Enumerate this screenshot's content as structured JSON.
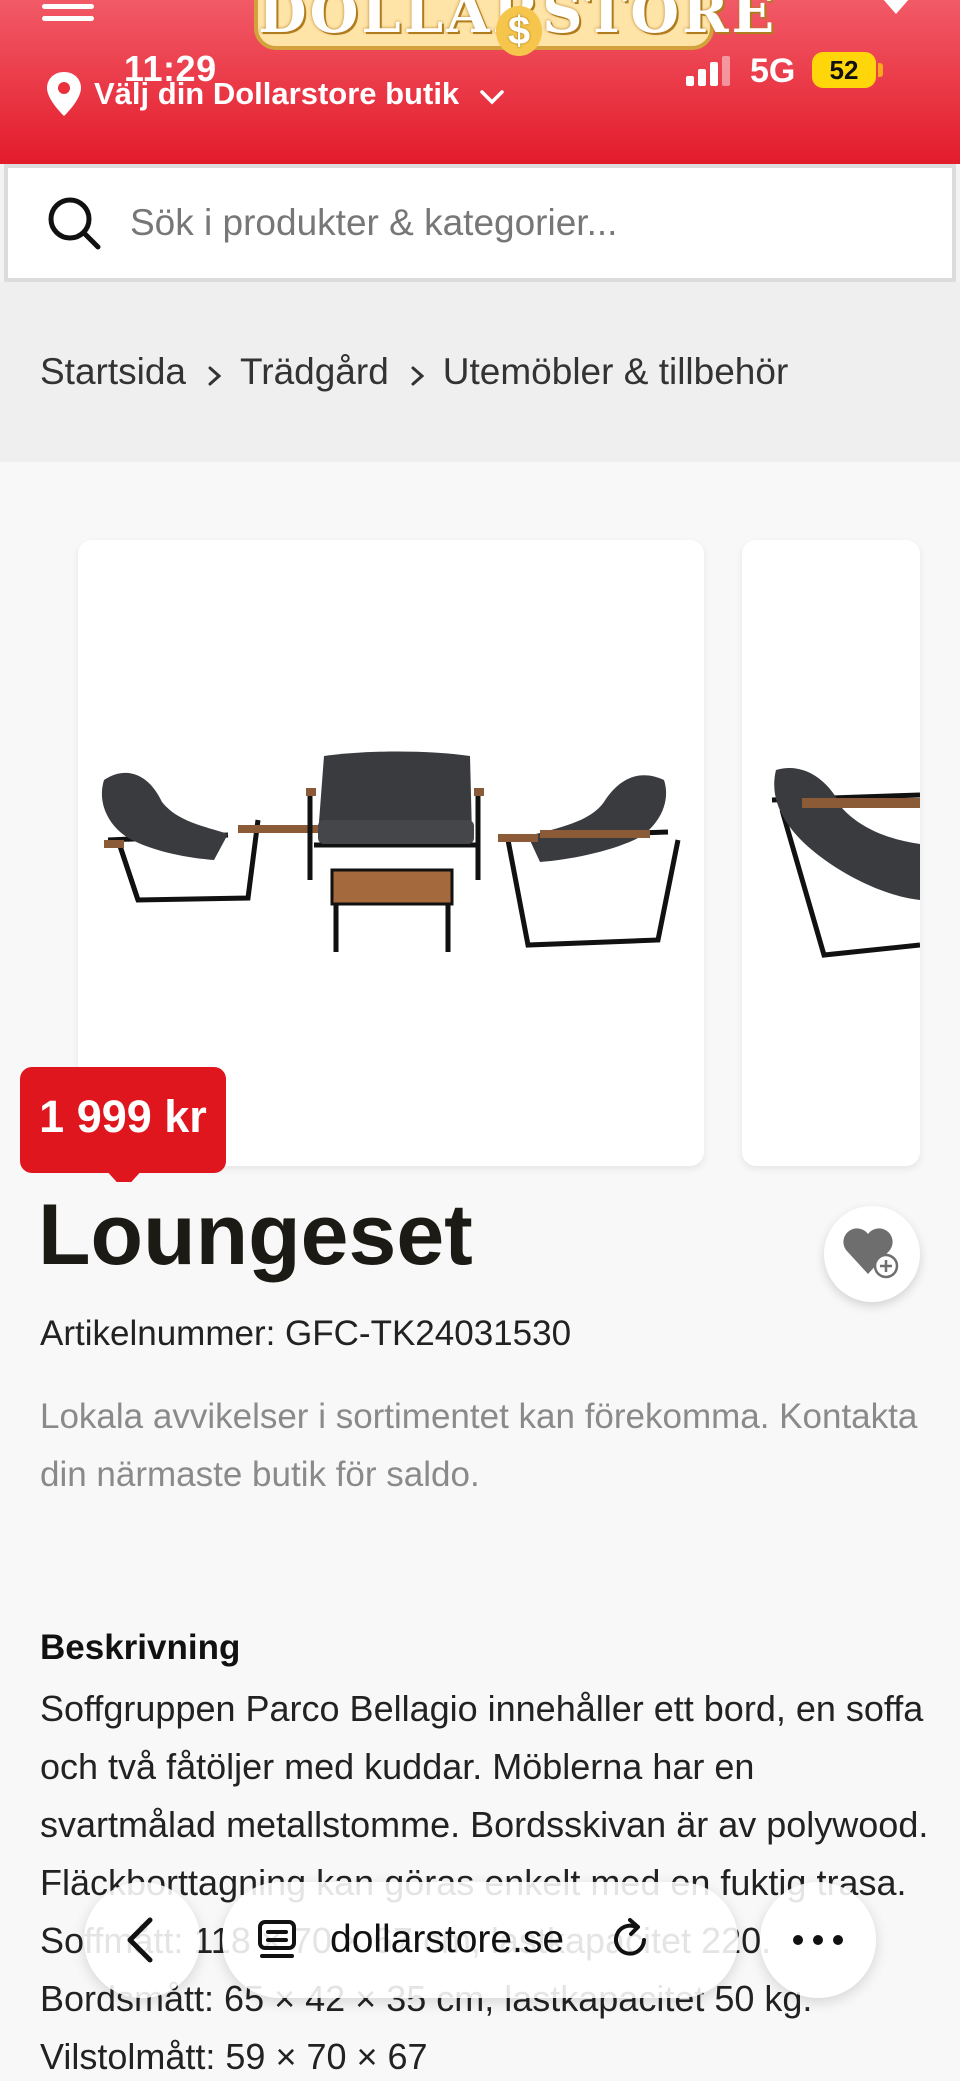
{
  "status": {
    "time": "11:29",
    "network": "5G",
    "battery": "52"
  },
  "header": {
    "logo_text": "DOLLARSTORE",
    "logo_symbol": "$",
    "store_label": "Välj din Dollarstore butik"
  },
  "search": {
    "placeholder": "Sök i produkter & kategorier..."
  },
  "breadcrumb": [
    "Startsida",
    "Trädgård",
    "Utemöbler & tillbehör"
  ],
  "product": {
    "price": "1 999 kr",
    "title": "Loungeset",
    "article_number": "Artikelnummer: GFC-TK24031530",
    "notice": "Lokala avvikelser i sortimentet kan förekomma. Kontakta din närmaste butik för saldo.",
    "description_heading": "Beskrivning",
    "description": "Soffgruppen Parco Bellagio innehåller ett bord, en soffa och två fåtöljer med kuddar. Möblerna har en svartmålad metallstomme. Bordsskivan är av polywood. Fläckborttagning kan göras enkelt med en fuktig trasa. Soffmått: 118 × 70 × 67 cm, lastkapacitet 220. Bordsmått: 65 × 42 × 35 cm, lastkapacitet 50 kg. Vilstolmått: 59 × 70 × 67"
  },
  "browser": {
    "url": "dollarstore.se"
  },
  "colors": {
    "brand_red": "#e31b2b",
    "price_red": "#e0161e",
    "battery": "#ffd60a"
  }
}
